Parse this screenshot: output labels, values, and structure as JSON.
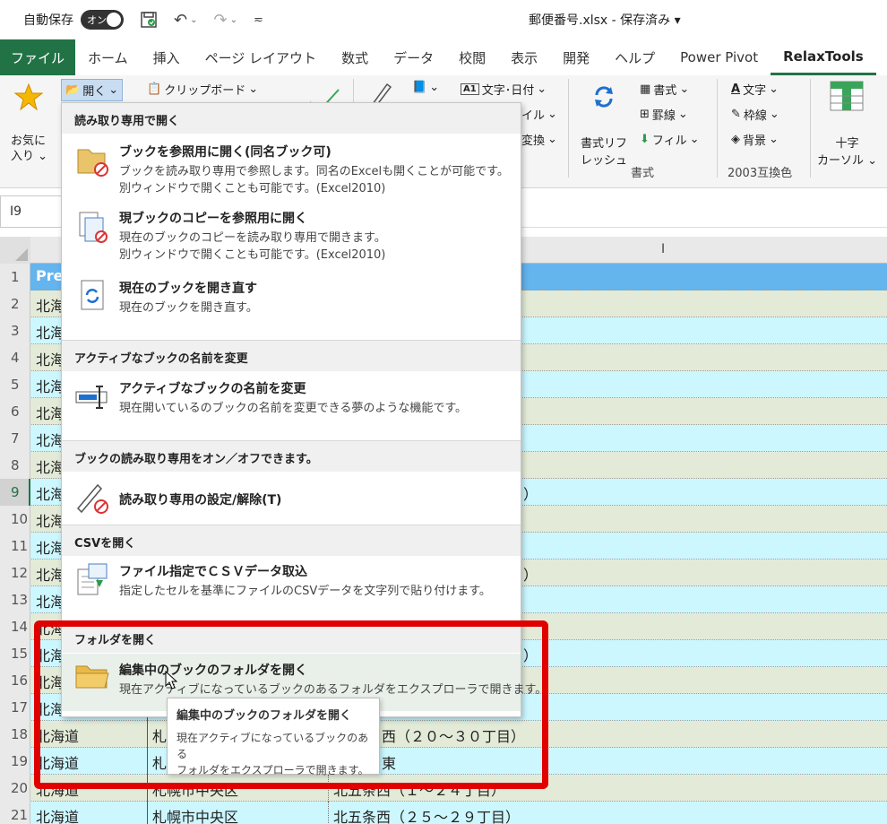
{
  "titlebar": {
    "autosave_label": "自動保存",
    "toggle_label": "オン",
    "doc_title": "郵便番号.xlsx - 保存済み ▾"
  },
  "tabs": [
    "ファイル",
    "ホーム",
    "挿入",
    "ページ レイアウト",
    "数式",
    "データ",
    "校閲",
    "表示",
    "開発",
    "ヘルプ",
    "Power Pivot",
    "RelaxTools"
  ],
  "ribbon": {
    "favorites": "お気に\n入り",
    "open": "開く",
    "clipboard": "クリップボード",
    "text_date": "文字･日付",
    "frag1": "イル",
    "frag2": "変換",
    "refresh_format": "書式リフ\nレッシュ",
    "format": "書式",
    "border": "罫線",
    "fill": "フィル",
    "text": "文字",
    "frame_line": "枠線",
    "background": "背景",
    "crosshair": "十字\nカーソル",
    "group_format": "書式",
    "group_2003": "2003互換色"
  },
  "namebox": "I9",
  "columns": [
    "I"
  ],
  "rows": [
    {
      "num": "1",
      "c1": "Pre",
      "c2": "",
      "c3": ""
    },
    {
      "num": "2",
      "c1": "北海",
      "c2": "",
      "c3": ""
    },
    {
      "num": "3",
      "c1": "北海",
      "c2": "",
      "c3": ""
    },
    {
      "num": "4",
      "c1": "北海",
      "c2": "",
      "c3": ""
    },
    {
      "num": "5",
      "c1": "北海",
      "c2": "",
      "c3": ""
    },
    {
      "num": "6",
      "c1": "北海",
      "c2": "",
      "c3": ""
    },
    {
      "num": "7",
      "c1": "北海",
      "c2": "",
      "c3": ""
    },
    {
      "num": "8",
      "c1": "北海",
      "c2": "",
      "c3": ""
    },
    {
      "num": "9",
      "c1": "北海",
      "c2": "",
      "c3": "）"
    },
    {
      "num": "10",
      "c1": "北海",
      "c2": "",
      "c3": ""
    },
    {
      "num": "11",
      "c1": "北海",
      "c2": "",
      "c3": ""
    },
    {
      "num": "12",
      "c1": "北海",
      "c2": "",
      "c3": "）"
    },
    {
      "num": "13",
      "c1": "北海",
      "c2": "",
      "c3": ""
    },
    {
      "num": "14",
      "c1": "北海",
      "c2": "",
      "c3": ""
    },
    {
      "num": "15",
      "c1": "北海",
      "c2": "",
      "c3": "）"
    },
    {
      "num": "16",
      "c1": "北海",
      "c2": "",
      "c3": ""
    },
    {
      "num": "17",
      "c1": "北海",
      "c2": "",
      "c3": ""
    },
    {
      "num": "18",
      "c1": "北海道",
      "c2": "札",
      "c3": "西（２０～３０丁目）"
    },
    {
      "num": "19",
      "c1": "北海道",
      "c2": "札",
      "c3": "東"
    },
    {
      "num": "20",
      "c1": "北海道",
      "c2": "札幌市中央区",
      "c3": "北五条西（１～２４丁目）"
    },
    {
      "num": "21",
      "c1": "北海道",
      "c2": "札幌市中央区",
      "c3": "北五条西（２５～２９丁目）"
    }
  ],
  "menu": {
    "sec1": "読み取り専用で開く",
    "item1_title": "ブックを参照用に開く(同名ブック可)",
    "item1_desc1": "ブックを読み取り専用で参照します。同名のExcelも開くことが可能です。",
    "item1_desc2": "別ウィンドウで開くことも可能です。(Excel2010)",
    "item2_title": "現ブックのコピーを参照用に開く",
    "item2_desc1": "現在のブックのコピーを読み取り専用で開きます。",
    "item2_desc2": "別ウィンドウで開くことも可能です。(Excel2010)",
    "item3_title": "現在のブックを開き直す",
    "item3_desc1": "現在のブックを開き直す。",
    "sec2": "アクティブなブックの名前を変更",
    "item4_title": "アクティブなブックの名前を変更",
    "item4_desc1": "現在開いているのブックの名前を変更できる夢のような機能です。",
    "sec3": "ブックの読み取り専用をオン／オフできます。",
    "item5_title": "読み取り専用の設定/解除(T)",
    "sec4": "CSVを開く",
    "item6_title": "ファイル指定でＣＳＶデータ取込",
    "item6_desc1": "指定したセルを基準にファイルのCSVデータを文字列で貼り付けます。",
    "sec5": "フォルダを開く",
    "item7_title": "編集中のブックのフォルダを開く",
    "item7_desc1": "現在アクティブになっているブックのあるフォルダをエクスプローラで開きます。"
  },
  "tooltip": {
    "title": "編集中のブックのフォルダを開く",
    "desc": "現在アクティブになっているブックのある\nフォルダをエクスプローラで開きます。"
  },
  "colors": {
    "excel_green": "#217346",
    "header_blue": "#64b4ee",
    "row_green": "#e3ebd8",
    "row_cyan": "#ccf7ff",
    "highlight_red": "#e00000"
  }
}
